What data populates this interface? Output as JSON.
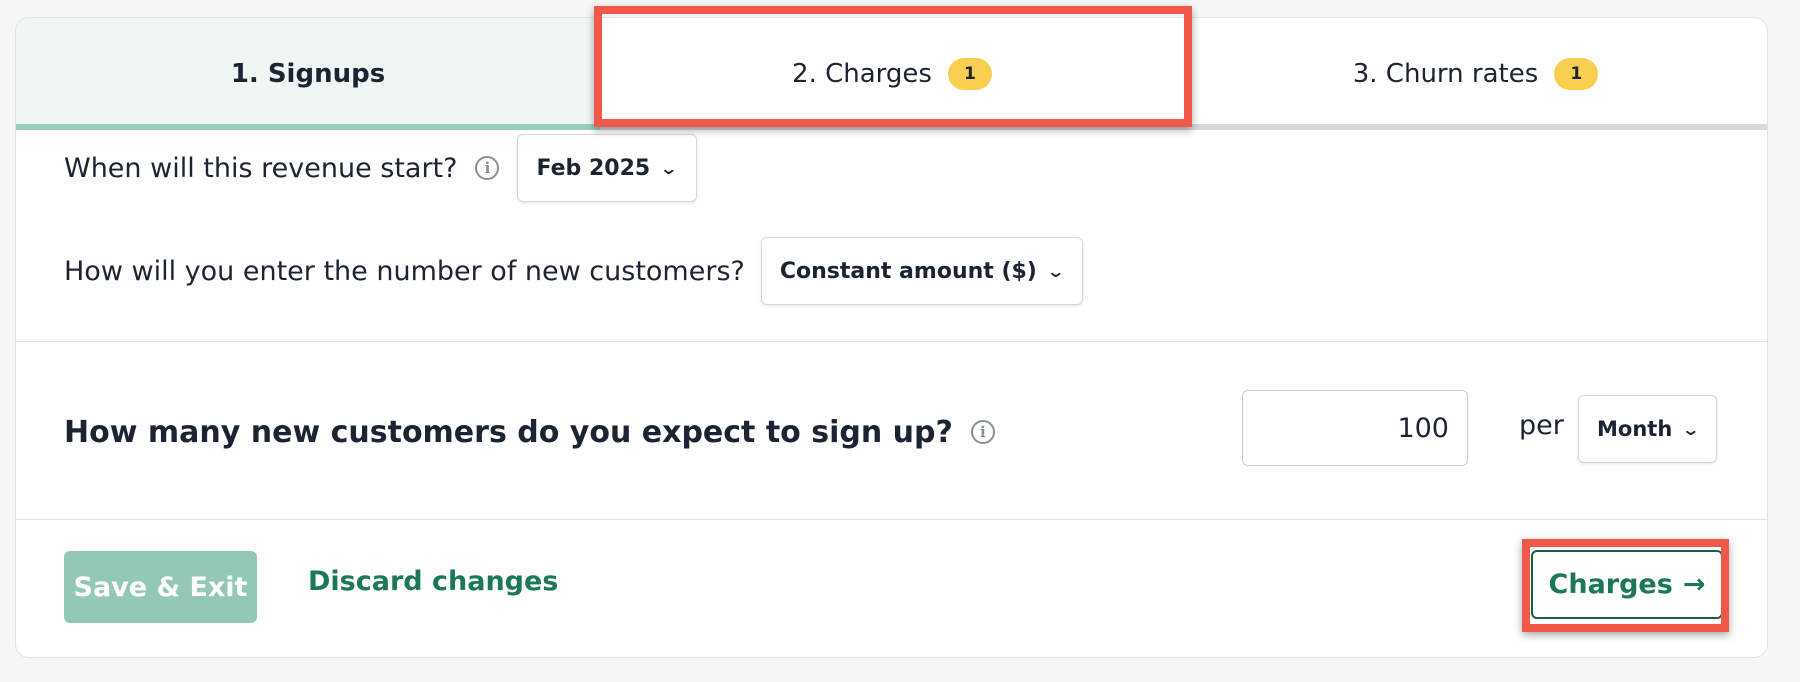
{
  "tabs": [
    {
      "label": "1. Signups",
      "badge": "",
      "active": true
    },
    {
      "label": "2. Charges",
      "badge": "1",
      "active": false
    },
    {
      "label": "3. Churn rates",
      "badge": "1",
      "active": false
    }
  ],
  "revenue_start": {
    "question": "When will this revenue start?",
    "info_icon": "info-icon",
    "selected": "Feb 2025"
  },
  "entry_method": {
    "question": "How will you enter the number of new customers?",
    "selected": "Constant amount ($)"
  },
  "signups": {
    "question": "How many new customers do you expect to sign up?",
    "info_icon": "info-icon",
    "value": "100",
    "per_label": "per",
    "period": "Month"
  },
  "footer": {
    "save_label": "Save & Exit",
    "discard_label": "Discard changes",
    "next_label": "Charges",
    "next_arrow": "→"
  },
  "colors": {
    "accent": "#1b7a55",
    "active_tab_bar": "#99cdbd",
    "badge": "#f9cf4f",
    "highlight": "#f0584a",
    "save_button_disabled": "#94c8b6"
  }
}
